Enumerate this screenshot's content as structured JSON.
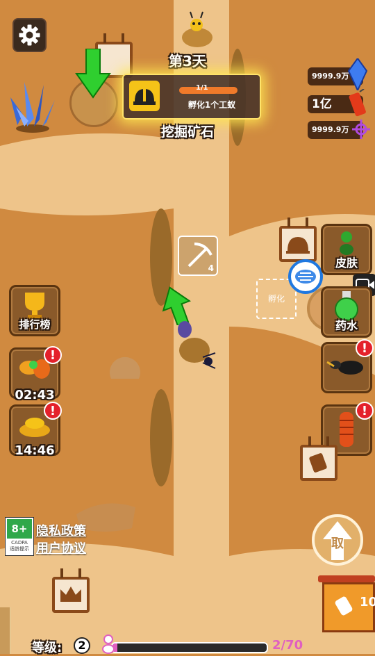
{
  "day_label": "第3天",
  "task": {
    "progress": "1/1",
    "progress_fraction": 1.0,
    "description": "孵化1个工蚁"
  },
  "task_title": "挖掘矿石",
  "resources": [
    {
      "name": "crystal",
      "value": "9999.9万",
      "icon": "blue-crystal-icon"
    },
    {
      "name": "firecracker",
      "value": "1亿",
      "icon": "firecracker-icon"
    },
    {
      "name": "gene",
      "value": "9999.9万",
      "icon": "purple-gene-icon"
    }
  ],
  "left_buttons": [
    {
      "label": "排行榜",
      "icon": "trophy-icon"
    },
    {
      "label": "02:43",
      "icon": "ant-boost-icon",
      "badge": "!"
    },
    {
      "label": "14:46",
      "icon": "gold-pile-icon",
      "badge": "!"
    }
  ],
  "right_buttons": [
    {
      "label": "皮肤",
      "icon": "ant-skin-icon"
    },
    {
      "label": "药水",
      "icon": "potion-flask-icon"
    },
    {
      "label": "",
      "icon": "soldier-ant-icon",
      "badge": "!"
    },
    {
      "label": "",
      "icon": "red-ant-icon",
      "badge": "!"
    }
  ],
  "hatch_label": "孵化",
  "pickaxe_count": "4",
  "age_rating": {
    "rating": "8+",
    "org": "CADPA",
    "hint": "适龄提示"
  },
  "privacy_link": "隐私政策",
  "agreement_link": "用户协议",
  "collect_button": "取",
  "level": {
    "label": "等级:",
    "value": "2",
    "exp": "2/70",
    "fraction": 0.03
  },
  "shop_count": "10",
  "colors": {
    "dirt": "#d08a40",
    "tunnel": "#eec48a",
    "highlight": "#f5d94a",
    "accent_green": "#2fcf2f"
  }
}
